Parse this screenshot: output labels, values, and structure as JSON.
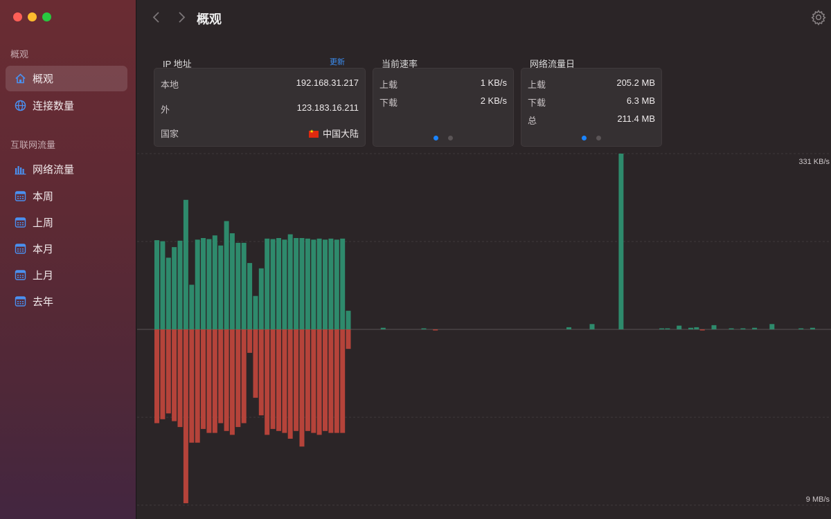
{
  "sidebar": {
    "section_overview": "概观",
    "section_internet": "互联网流量",
    "items": [
      {
        "label": "概观",
        "icon": "home-icon",
        "active": true
      },
      {
        "label": "连接数量",
        "icon": "globe-icon"
      },
      {
        "label": "网络流量",
        "icon": "bar-chart-icon"
      },
      {
        "label": "本周",
        "icon": "calendar-icon"
      },
      {
        "label": "上周",
        "icon": "calendar-icon"
      },
      {
        "label": "本月",
        "icon": "calendar-icon"
      },
      {
        "label": "上月",
        "icon": "calendar-icon"
      },
      {
        "label": "去年",
        "icon": "calendar-icon"
      }
    ]
  },
  "header": {
    "title": "概观"
  },
  "ip_card": {
    "title": "IP 地址",
    "refresh": "更新",
    "local_label": "本地",
    "local_value": "192.168.31.217",
    "external_label": "外",
    "external_value": "123.183.16.211",
    "country_label": "国家",
    "country_value": "中国大陆"
  },
  "speed_card": {
    "title": "当前速率",
    "up_label": "上载",
    "up_value": "1 KB/s",
    "down_label": "下载",
    "down_value": "2 KB/s"
  },
  "traffic_card": {
    "title": "网络流量日",
    "up_label": "上载",
    "up_value": "205.2 MB",
    "down_label": "下载",
    "down_value": "6.3 MB",
    "total_label": "总",
    "total_value": "211.4 MB"
  },
  "colors": {
    "upload": "#2e8a6c",
    "download": "#b5433a",
    "accent": "#1a84ff"
  },
  "chart_data": {
    "type": "bar",
    "upper_label": "331 KB/s",
    "lower_label": "9 MB/s",
    "upload_max": 331,
    "download_max": 9,
    "upload": [
      168,
      166,
      135,
      155,
      167,
      244,
      84,
      169,
      172,
      170,
      177,
      158,
      204,
      181,
      163,
      163,
      125,
      63,
      115,
      171,
      170,
      172,
      169,
      179,
      172,
      172,
      171,
      169,
      171,
      169,
      171,
      169,
      171,
      35,
      0,
      0,
      0,
      0,
      0,
      3,
      0,
      0,
      0,
      0,
      0,
      0,
      2,
      0,
      0,
      0,
      0,
      0,
      0,
      0,
      0,
      0,
      0,
      0,
      0,
      0,
      0,
      0,
      0,
      0,
      0,
      0,
      0,
      0,
      0,
      0,
      0,
      4,
      0,
      0,
      0,
      10,
      0,
      0,
      0,
      0,
      331,
      0,
      0,
      0,
      0,
      0,
      0,
      2,
      2,
      0,
      7,
      0,
      3,
      4,
      0,
      0,
      8,
      0,
      0,
      2,
      0,
      2,
      0,
      3,
      0,
      0,
      10,
      0,
      0,
      0,
      0,
      2,
      0,
      3,
      0,
      0,
      0,
      0
    ],
    "download": [
      4.8,
      4.6,
      4.3,
      4.7,
      5.0,
      8.9,
      5.8,
      5.8,
      5.1,
      5.3,
      5.3,
      4.8,
      5.2,
      5.4,
      5.0,
      4.8,
      1.2,
      3.5,
      4.4,
      5.4,
      5.1,
      5.2,
      5.3,
      5.6,
      5.2,
      6.0,
      5.2,
      5.3,
      5.4,
      5.2,
      5.3,
      5.3,
      5.3,
      1.0,
      0,
      0,
      0,
      0,
      0,
      0,
      0,
      0,
      0,
      0,
      0,
      0,
      0,
      0,
      0.03,
      0,
      0,
      0,
      0,
      0,
      0,
      0,
      0,
      0,
      0,
      0,
      0,
      0,
      0,
      0,
      0,
      0,
      0,
      0,
      0,
      0,
      0,
      0,
      0,
      0,
      0,
      0,
      0,
      0,
      0,
      0,
      0,
      0,
      0,
      0,
      0,
      0,
      0,
      0,
      0,
      0,
      0,
      0,
      0,
      0,
      0.03,
      0,
      0,
      0,
      0,
      0,
      0,
      0,
      0,
      0,
      0,
      0,
      0,
      0,
      0,
      0,
      0,
      0,
      0,
      0,
      0,
      0,
      0,
      0
    ]
  }
}
